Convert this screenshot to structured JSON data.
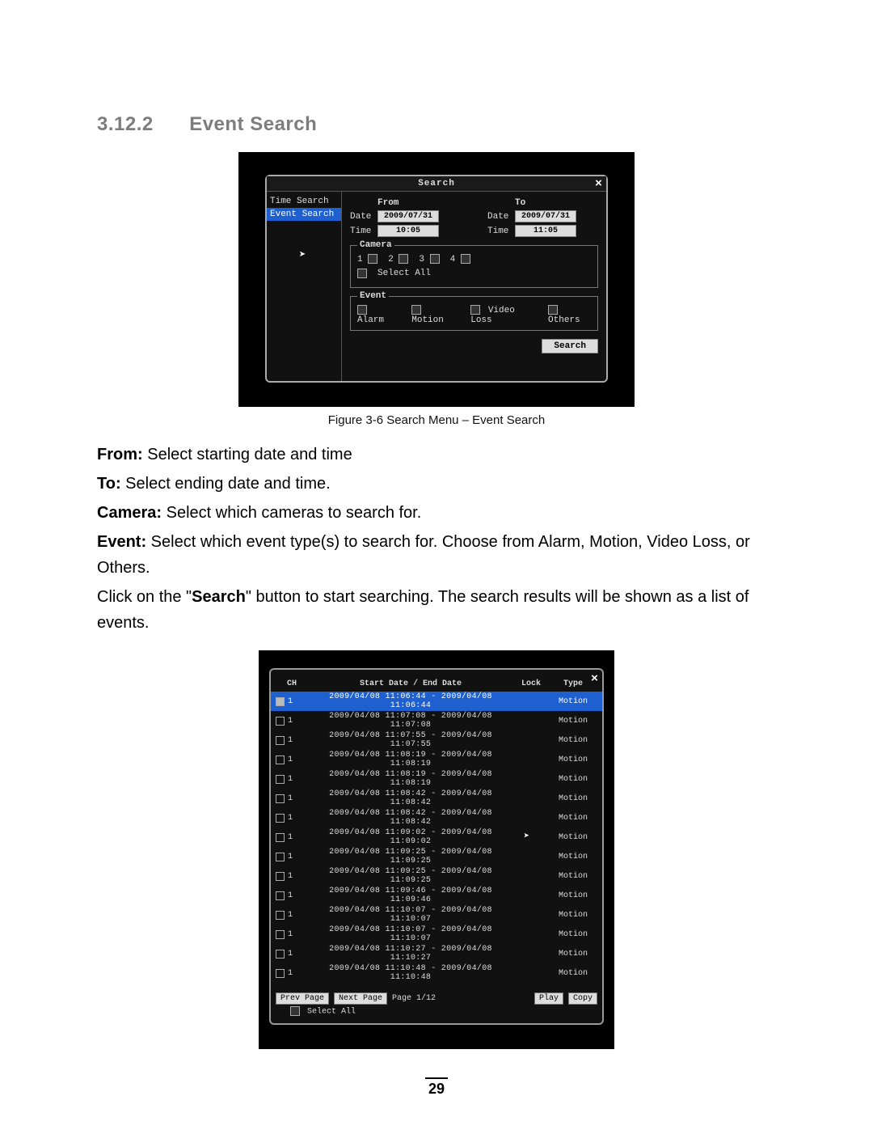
{
  "heading": {
    "number": "3.12.2",
    "title": "Event Search"
  },
  "fig1": {
    "dialog_title": "Search",
    "sidebar": [
      "Time Search",
      "Event Search"
    ],
    "sidebar_selected": 1,
    "from_label": "From",
    "to_label": "To",
    "date_label": "Date",
    "time_label": "Time",
    "from_date": "2009/07/31",
    "from_time": "10:05",
    "to_date": "2009/07/31",
    "to_time": "11:05",
    "camera_legend": "Camera",
    "cameras": [
      "1",
      "2",
      "3",
      "4"
    ],
    "select_all": "Select All",
    "event_legend": "Event",
    "events": [
      "Alarm",
      "Motion",
      "Video Loss",
      "Others"
    ],
    "search_btn": "Search",
    "caption": "Figure 3-6 Search Menu – Event Search"
  },
  "body": {
    "from_l": "From:",
    "from_t": " Select starting date and time",
    "to_l": "To:",
    "to_t": " Select ending date and time.",
    "cam_l": "Camera:",
    "cam_t": " Select which cameras to search for.",
    "ev_l": "Event:",
    "ev_t": " Select which event type(s) to search for. Choose from Alarm, Motion, Video Loss, or Others.",
    "click_a": "Click on the \"",
    "click_b": "Search",
    "click_c": "\" button to start searching. The search results will be shown as a list of events."
  },
  "fig2": {
    "head": {
      "ch": "CH",
      "dates": "Start Date / End Date",
      "lock": "Lock",
      "type": "Type"
    },
    "rows": [
      {
        "ch": "1",
        "d": "2009/04/08 11:06:44 - 2009/04/08 11:06:44",
        "t": "Motion",
        "sel": true
      },
      {
        "ch": "1",
        "d": "2009/04/08 11:07:08 - 2009/04/08 11:07:08",
        "t": "Motion"
      },
      {
        "ch": "1",
        "d": "2009/04/08 11:07:55 - 2009/04/08 11:07:55",
        "t": "Motion"
      },
      {
        "ch": "1",
        "d": "2009/04/08 11:08:19 - 2009/04/08 11:08:19",
        "t": "Motion"
      },
      {
        "ch": "1",
        "d": "2009/04/08 11:08:19 - 2009/04/08 11:08:19",
        "t": "Motion"
      },
      {
        "ch": "1",
        "d": "2009/04/08 11:08:42 - 2009/04/08 11:08:42",
        "t": "Motion"
      },
      {
        "ch": "1",
        "d": "2009/04/08 11:08:42 - 2009/04/08 11:08:42",
        "t": "Motion"
      },
      {
        "ch": "1",
        "d": "2009/04/08 11:09:02 - 2009/04/08 11:09:02",
        "t": "Motion"
      },
      {
        "ch": "1",
        "d": "2009/04/08 11:09:25 - 2009/04/08 11:09:25",
        "t": "Motion"
      },
      {
        "ch": "1",
        "d": "2009/04/08 11:09:25 - 2009/04/08 11:09:25",
        "t": "Motion"
      },
      {
        "ch": "1",
        "d": "2009/04/08 11:09:46 - 2009/04/08 11:09:46",
        "t": "Motion"
      },
      {
        "ch": "1",
        "d": "2009/04/08 11:10:07 - 2009/04/08 11:10:07",
        "t": "Motion"
      },
      {
        "ch": "1",
        "d": "2009/04/08 11:10:07 - 2009/04/08 11:10:07",
        "t": "Motion"
      },
      {
        "ch": "1",
        "d": "2009/04/08 11:10:27 - 2009/04/08 11:10:27",
        "t": "Motion"
      },
      {
        "ch": "1",
        "d": "2009/04/08 11:10:48 - 2009/04/08 11:10:48",
        "t": "Motion"
      }
    ],
    "prev": "Prev Page",
    "next": "Next Page",
    "page": "Page 1/12",
    "play": "Play",
    "copy": "Copy",
    "select_all": "Select All"
  },
  "page_number": "29"
}
